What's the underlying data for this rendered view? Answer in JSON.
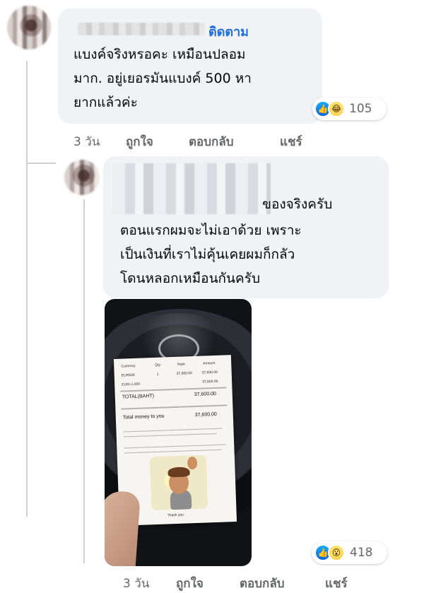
{
  "comments": [
    {
      "id": "comment-1",
      "follow_label": "ติดตาม",
      "text_lines": [
        "แบงค์จริงหรอคะ เหมือนปลอม",
        "มาก. อยู่เยอรมันแบงค์ 500 หา",
        "ยากแล้วค่ะ"
      ],
      "reactions": {
        "icons": [
          "like-icon",
          "haha-icon"
        ],
        "count": "105"
      },
      "actions": {
        "time": "3 วัน",
        "like": "ถูกใจ",
        "reply": "ตอบกลับ",
        "share": "แชร์"
      }
    },
    {
      "id": "reply-1",
      "text_lines": [
        "ของจริงครับ",
        "ตอนแรกผมจะไม่เอาด้วย เพราะ",
        "เป็นเงินที่เราไม่คุ้นเคยผมก็กลัว",
        "โดนหลอกเหมือนกันครับ"
      ],
      "photo": {
        "receipt_header": [
          "Currency",
          "Qty",
          "Rate",
          "Amount"
        ],
        "receipt_rows": [
          [
            "EUR500",
            "1",
            "37,600.00",
            "37,600.00"
          ],
          [
            "EUR=1,000",
            "",
            "",
            "37,600.00"
          ]
        ],
        "receipt_total_label": "TOTAL(BAHT)",
        "receipt_total_value": "37,600.00",
        "receipt_note": "Total money to you",
        "receipt_money_value": "37,600.00",
        "receipt_footer": "Thank you"
      },
      "reactions": {
        "icons": [
          "like-icon",
          "wow-icon"
        ],
        "count": "418"
      },
      "actions": {
        "time": "3 วัน",
        "like": "ถูกใจ",
        "reply": "ตอบกลับ",
        "share": "แชร์"
      }
    }
  ]
}
